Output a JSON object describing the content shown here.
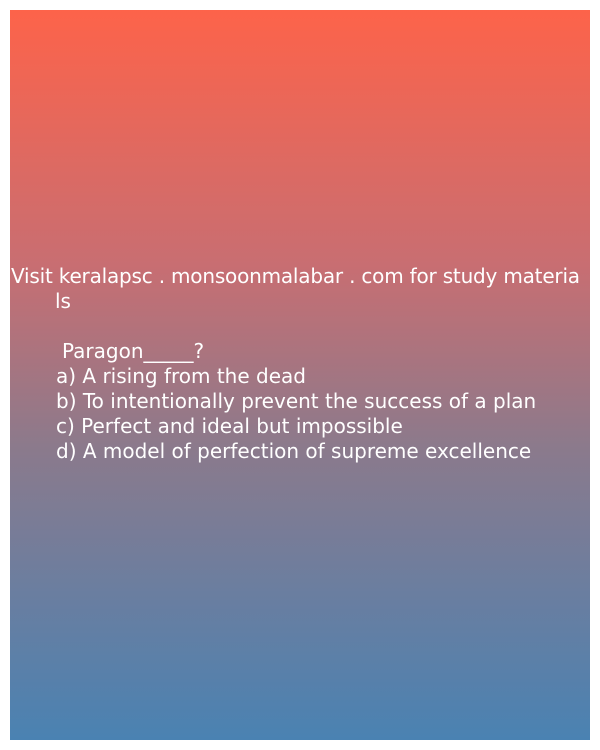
{
  "watermark": {
    "line1": "Visit keralapsc . monsoonmalabar . com for study materia",
    "line2": "ls"
  },
  "question": {
    "text": "Paragon_____?"
  },
  "options": [
    "a) A rising from the dead",
    "b) To intentionally prevent the success of a plan",
    "c) Perfect and ideal but impossible",
    "d) A model of perfection of supreme excellence"
  ],
  "colors": {
    "gradient_top": "#fd634a",
    "gradient_bottom": "#4a82b2",
    "text": "#ffffff",
    "border": "#ffffff"
  }
}
